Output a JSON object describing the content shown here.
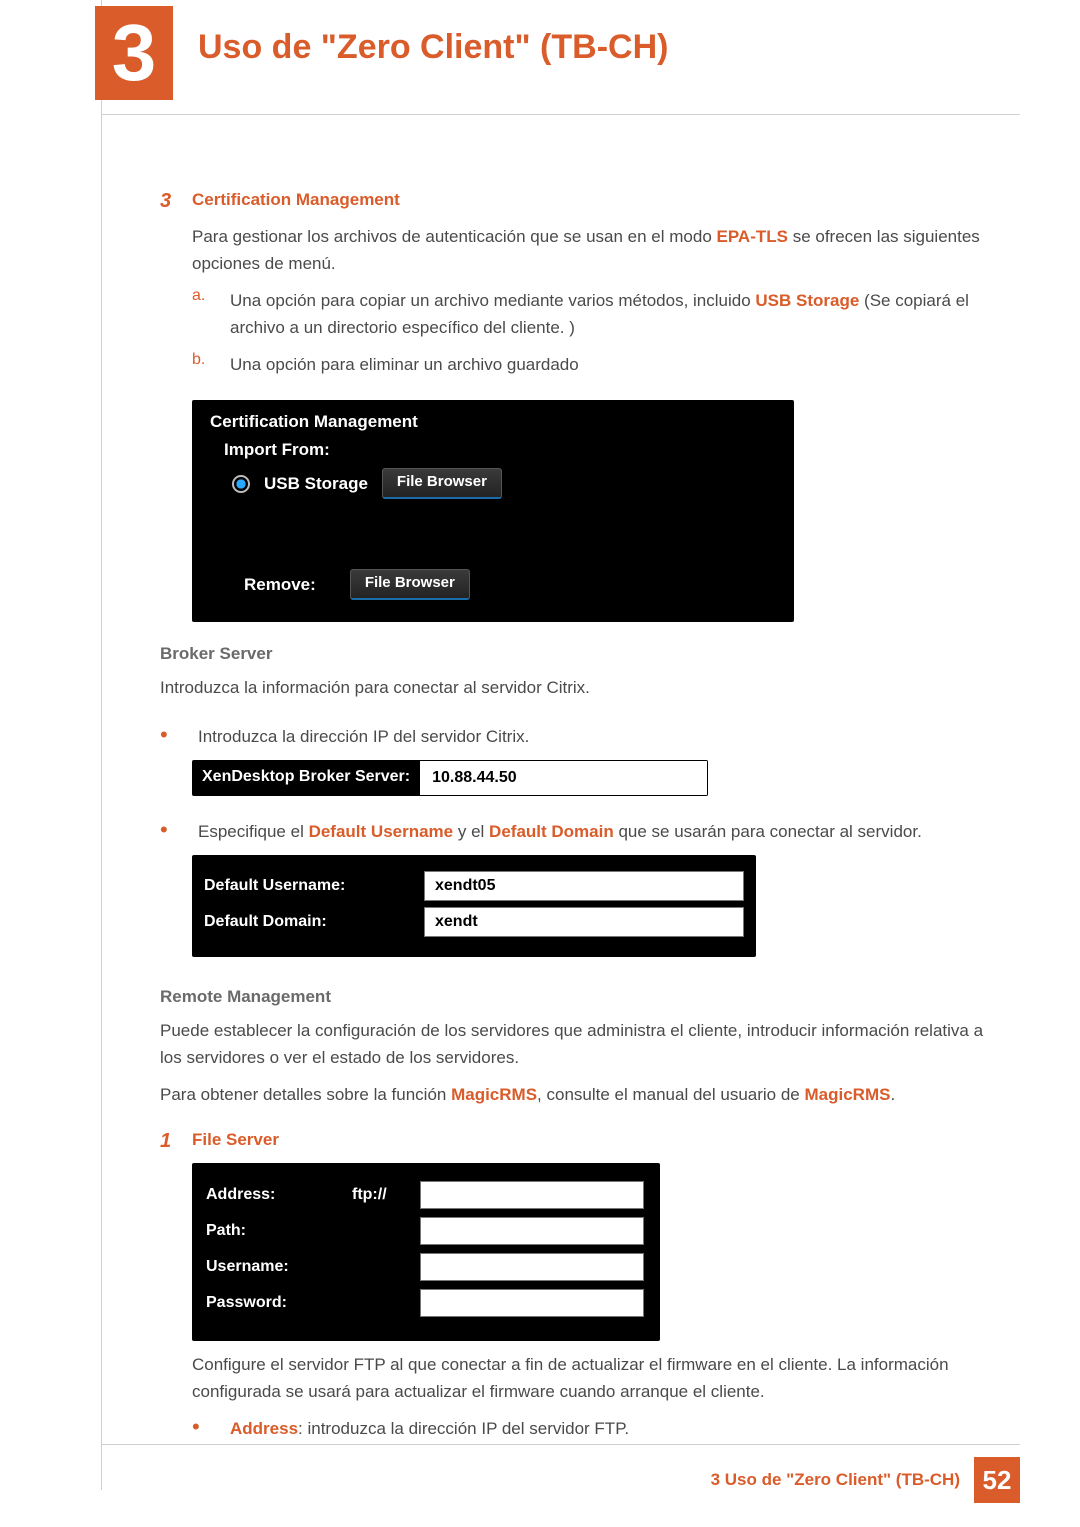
{
  "chapter": {
    "number": "3",
    "title": "Uso de \"Zero Client\" (TB-CH)"
  },
  "sec_cert": {
    "num": "3",
    "heading": "Certification Management",
    "intro_before": "Para gestionar los archivos de autenticación que se usan en el modo ",
    "intro_em": "EPA-TLS",
    "intro_after": " se ofrecen las siguientes opciones de menú.",
    "a_num": "a.",
    "a_before": "Una opción para copiar un archivo mediante varios métodos, incluido ",
    "a_em": "USB Storage",
    "a_after": " (Se copiará el archivo a un directorio específico del cliente. )",
    "b_num": "b.",
    "b_text": "Una opción para eliminar un archivo guardado"
  },
  "shot1": {
    "title": "Certification Management",
    "import_from": "Import From:",
    "usb_storage": "USB Storage",
    "file_browser": "File Browser",
    "remove": "Remove:"
  },
  "sec_broker": {
    "heading": "Broker Server",
    "intro": "Introduzca la información para conectar al servidor Citrix.",
    "b1": "Introduzca la dirección IP del servidor Citrix.",
    "b2_before": "Especifique el ",
    "b2_em1": "Default Username",
    "b2_mid": " y el ",
    "b2_em2": "Default Domain",
    "b2_after": " que se usarán para conectar al servidor."
  },
  "shot2": {
    "label": "XenDesktop Broker Server:",
    "value": "10.88.44.50"
  },
  "shot3": {
    "row1_label": "Default Username:",
    "row1_value": "xendt05",
    "row2_label": "Default Domain:",
    "row2_value": "xendt"
  },
  "sec_remote": {
    "heading": "Remote Management",
    "p1": "Puede establecer la configuración de los servidores que administra el cliente, introducir información relativa a los servidores o ver el estado de los servidores.",
    "p2_before": "Para obtener detalles sobre la función ",
    "p2_em1": "MagicRMS",
    "p2_mid": ", consulte el manual del usuario de ",
    "p2_em2": "MagicRMS",
    "p2_after": "."
  },
  "sec_fs": {
    "num": "1",
    "heading": "File Server"
  },
  "shot4": {
    "address": "Address:",
    "ftp": "ftp://",
    "path": "Path:",
    "username": "Username:",
    "password": "Password:"
  },
  "after_fs": {
    "p1": "Configure el servidor FTP al que conectar a fin de actualizar el firmware en el cliente. La información configurada se usará para actualizar el firmware cuando arranque el cliente.",
    "b1_em": "Address",
    "b1_after": ": introduzca la dirección IP del servidor FTP."
  },
  "footer": {
    "text": "3 Uso de \"Zero Client\" (TB-CH)",
    "page": "52"
  }
}
